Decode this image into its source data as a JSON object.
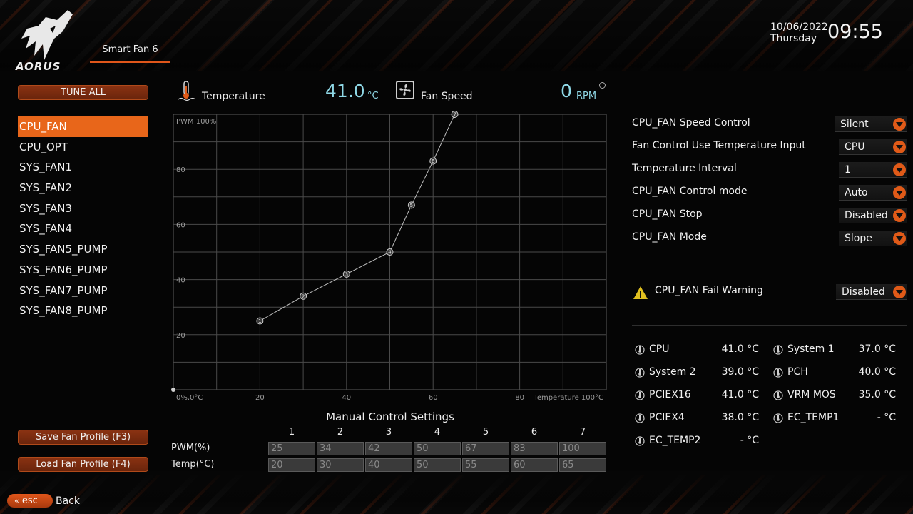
{
  "header": {
    "brand": "AORUS",
    "page_tab": "Smart Fan 6",
    "date": "10/06/2022",
    "weekday": "Thursday",
    "time": "09:55"
  },
  "left": {
    "tune_all": "TUNE ALL",
    "fans": [
      "CPU_FAN",
      "CPU_OPT",
      "SYS_FAN1",
      "SYS_FAN2",
      "SYS_FAN3",
      "SYS_FAN4",
      "SYS_FAN5_PUMP",
      "SYS_FAN6_PUMP",
      "SYS_FAN7_PUMP",
      "SYS_FAN8_PUMP"
    ],
    "active_fan": "CPU_FAN",
    "save_profile": "Save Fan Profile (F3)",
    "load_profile": "Load Fan Profile (F4)"
  },
  "footer": {
    "esc": "esc",
    "back": "Back"
  },
  "monitor": {
    "temp_label": "Temperature",
    "temp_value": "41.0",
    "temp_unit": "°C",
    "fan_label": "Fan Speed",
    "rpm_value": "0",
    "rpm_unit": "RPM"
  },
  "chart_data": {
    "type": "line",
    "y_top_label": "PWM 100%",
    "x_right_label": "Temperature 100°C",
    "origin_label": "0%,0°C",
    "x_ticks": [
      "20",
      "40",
      "60",
      "80"
    ],
    "y_ticks": [
      "80",
      "60",
      "40",
      "20"
    ],
    "xlim": [
      0,
      100
    ],
    "ylim": [
      0,
      100
    ],
    "grid": true,
    "points": [
      {
        "label": "1",
        "temp": 20,
        "pwm": 25
      },
      {
        "label": "2",
        "temp": 30,
        "pwm": 34
      },
      {
        "label": "3",
        "temp": 40,
        "pwm": 42
      },
      {
        "label": "4",
        "temp": 50,
        "pwm": 50
      },
      {
        "label": "5",
        "temp": 55,
        "pwm": 67
      },
      {
        "label": "6",
        "temp": 60,
        "pwm": 83
      },
      {
        "label": "7",
        "temp": 65,
        "pwm": 100
      }
    ]
  },
  "manual": {
    "title": "Manual Control Settings",
    "columns": [
      "1",
      "2",
      "3",
      "4",
      "5",
      "6",
      "7"
    ],
    "pwm_label": "PWM(%)",
    "temp_label": "Temp(°C)",
    "pwm": [
      "25",
      "34",
      "42",
      "50",
      "67",
      "83",
      "100"
    ],
    "temp": [
      "20",
      "30",
      "40",
      "50",
      "55",
      "60",
      "65"
    ]
  },
  "settings": [
    {
      "label": "CPU_FAN Speed Control",
      "value": "Silent"
    },
    {
      "label": "Fan Control Use Temperature Input",
      "value": "CPU"
    },
    {
      "label": "Temperature Interval",
      "value": "1"
    },
    {
      "label": "CPU_FAN Control mode",
      "value": "Auto"
    },
    {
      "label": "CPU_FAN Stop",
      "value": "Disabled"
    },
    {
      "label": "CPU_FAN Mode",
      "value": "Slope"
    }
  ],
  "fail_warning": {
    "label": "CPU_FAN Fail Warning",
    "value": "Disabled"
  },
  "sensors": [
    {
      "name": "CPU",
      "value": "41.0 °C"
    },
    {
      "name": "System 1",
      "value": "37.0 °C"
    },
    {
      "name": "System 2",
      "value": "39.0 °C"
    },
    {
      "name": "PCH",
      "value": "40.0 °C"
    },
    {
      "name": "PCIEX16",
      "value": "41.0 °C"
    },
    {
      "name": "VRM MOS",
      "value": "35.0 °C"
    },
    {
      "name": "PCIEX4",
      "value": "38.0 °C"
    },
    {
      "name": "EC_TEMP1",
      "value": "- °C"
    },
    {
      "name": "EC_TEMP2",
      "value": "- °C"
    }
  ],
  "colors": {
    "accent": "#e8661a",
    "readout": "#8fd8e6",
    "warning": "#e0c020"
  }
}
